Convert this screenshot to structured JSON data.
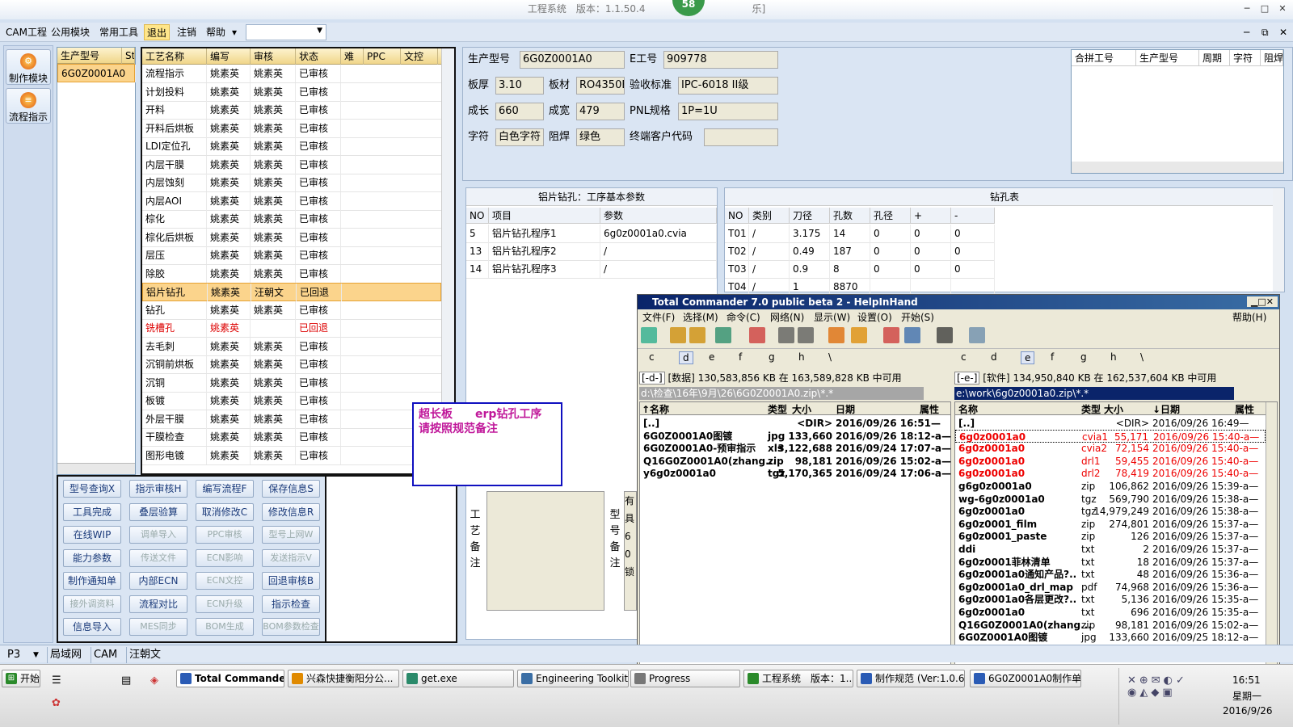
{
  "title": {
    "text": "工程系统　版本：1.1.50.4　　　　　　　　　　　乐]",
    "badge": "58",
    "min": "─",
    "max": "□",
    "close": "✕"
  },
  "menu": [
    "CAM工程",
    "公用模块",
    "常用工具",
    "退出",
    "注销",
    "帮助",
    "▾"
  ],
  "mdi_controls": {
    "min": "─",
    "restore": "⧉",
    "close": "✕"
  },
  "nav": [
    {
      "label": "制作模块",
      "icon": "gear-icon"
    },
    {
      "label": "流程指示",
      "icon": "flow-icon"
    }
  ],
  "prodlist": {
    "headers": [
      "生产型号",
      "St"
    ],
    "rows": [
      "6G0Z0001A0"
    ]
  },
  "process": {
    "headers": [
      "工艺名称",
      "编写",
      "审核",
      "状态",
      "难",
      "PPC",
      "文控"
    ],
    "rows": [
      [
        "流程指示",
        "姚素英",
        "姚素英",
        "已审核"
      ],
      [
        "计划投料",
        "姚素英",
        "姚素英",
        "已审核"
      ],
      [
        "开料",
        "姚素英",
        "姚素英",
        "已审核"
      ],
      [
        "开料后烘板",
        "姚素英",
        "姚素英",
        "已审核"
      ],
      [
        "LDI定位孔",
        "姚素英",
        "姚素英",
        "已审核"
      ],
      [
        "内层干膜",
        "姚素英",
        "姚素英",
        "已审核"
      ],
      [
        "内层蚀刻",
        "姚素英",
        "姚素英",
        "已审核"
      ],
      [
        "内层AOI",
        "姚素英",
        "姚素英",
        "已审核"
      ],
      [
        "棕化",
        "姚素英",
        "姚素英",
        "已审核"
      ],
      [
        "棕化后烘板",
        "姚素英",
        "姚素英",
        "已审核"
      ],
      [
        "层压",
        "姚素英",
        "姚素英",
        "已审核"
      ],
      [
        "除胶",
        "姚素英",
        "姚素英",
        "已审核"
      ],
      [
        "铝片钻孔",
        "姚素英",
        "汪朝文",
        "已回退"
      ],
      [
        "钻孔",
        "姚素英",
        "姚素英",
        "已审核"
      ],
      [
        "铣槽孔",
        "姚素英",
        "",
        "已回退"
      ],
      [
        "去毛刺",
        "姚素英",
        "姚素英",
        "已审核"
      ],
      [
        "沉铜前烘板",
        "姚素英",
        "姚素英",
        "已审核"
      ],
      [
        "沉铜",
        "姚素英",
        "姚素英",
        "已审核"
      ],
      [
        "板镀",
        "姚素英",
        "姚素英",
        "已审核"
      ],
      [
        "外层干膜",
        "姚素英",
        "姚素英",
        "已审核"
      ],
      [
        "干膜检查",
        "姚素英",
        "姚素英",
        "已审核"
      ],
      [
        "图形电镀",
        "姚素英",
        "姚素英",
        "已审核"
      ]
    ],
    "selected_index": 12,
    "red_index": 14
  },
  "info": {
    "prod_label": "生产型号",
    "prod_value": "6G0Z0001A0",
    "e_label": "E工号",
    "e_value": "909778",
    "thick_label": "板厚",
    "thick_value": "3.10",
    "mat_label": "板材",
    "mat_value": "RO4350B",
    "std_label": "验收标准",
    "std_value": "IPC-6018 II级",
    "len_label": "成长",
    "len_value": "660",
    "wid_label": "成宽",
    "wid_value": "479",
    "pnl_label": "PNL规格",
    "pnl_value": "1P=1U",
    "char_label": "字符",
    "char_value": "白色字符",
    "mask_label": "阻焊",
    "mask_value": "绿色",
    "cust_label": "终端客户代码",
    "cust_value": ""
  },
  "merge": {
    "headers": [
      "合拼工号",
      "生产型号",
      "周期",
      "字符",
      "阻焊"
    ]
  },
  "alu": {
    "title": "铝片钻孔：工序基本参数",
    "headers": [
      "NO",
      "项目",
      "参数"
    ],
    "rows": [
      [
        "5",
        "铝片钻孔程序1",
        "6g0z0001a0.cvia"
      ],
      [
        "13",
        "铝片钻孔程序2",
        "/"
      ],
      [
        "14",
        "铝片钻孔程序3",
        "/"
      ]
    ]
  },
  "drill": {
    "title": "钻孔表",
    "headers": [
      "NO",
      "类别",
      "刀径",
      "孔数",
      "孔径",
      "+",
      "-"
    ],
    "rows": [
      [
        "T01",
        "/",
        "3.175",
        "14",
        "0",
        "0",
        "0"
      ],
      [
        "T02",
        "/",
        "0.49",
        "187",
        "0",
        "0",
        "0"
      ],
      [
        "T03",
        "/",
        "0.9",
        "8",
        "0",
        "0",
        "0"
      ],
      [
        "T04",
        "/",
        "1",
        "8870",
        "",
        "",
        ""
      ]
    ]
  },
  "note_popup": "超长板　　erp钻孔工序\n请按照规范备注",
  "buttons": [
    [
      "型号查询X",
      "指示审核H",
      "编写流程F",
      "保存信息S"
    ],
    [
      "工具完成",
      "叠层验算",
      "取消修改C",
      "修改信息R"
    ],
    [
      "在线WIP",
      "调单导入",
      "PPC审核",
      "型号上网W"
    ],
    [
      "能力参数",
      "传送文件",
      "ECN影响",
      "发送指示V"
    ],
    [
      "制作通知单",
      "内部ECN",
      "ECN文控",
      "回退审核B"
    ],
    [
      "接外调资料",
      "流程对比",
      "ECN升级",
      "指示检查"
    ],
    [
      "信息导入",
      "MES同步",
      "BOM生成",
      "BOM参数检查"
    ]
  ],
  "buttons_disabled": [
    [
      2,
      1
    ],
    [
      2,
      2
    ],
    [
      2,
      3
    ],
    [
      3,
      1
    ],
    [
      3,
      2
    ],
    [
      3,
      3
    ],
    [
      4,
      2
    ],
    [
      5,
      0
    ],
    [
      5,
      2
    ],
    [
      6,
      1
    ],
    [
      6,
      2
    ],
    [
      6,
      3
    ]
  ],
  "remarks": {
    "process": "工艺备注",
    "model": "型号备注",
    "model_short": "有具60锁"
  },
  "tc": {
    "title": "Total Commander 7.0 public beta 2 - HelpInHand",
    "menu": [
      "文件(F)",
      "选择(M)",
      "命令(C)",
      "网络(N)",
      "显示(W)",
      "设置(O)",
      "开始(S)"
    ],
    "help": "帮助(H)",
    "left": {
      "drive": "[-d-]",
      "vol": "[数据]",
      "free": "130,583,856 KB 在 163,589,828 KB 中可用",
      "path": "d:\\检查\\16年\\9月\\26\\6G0Z0001A0.zip\\*.*",
      "drives": [
        "c",
        "d",
        "e",
        "f",
        "g",
        "h",
        "\\"
      ],
      "headers": [
        "↑名称",
        "类型",
        "大小",
        "日期",
        "属性"
      ],
      "files": [
        [
          "[..]",
          "",
          "<DIR>",
          "2016/09/26 16:51—",
          ""
        ],
        [
          "6G0Z0001A0图镀",
          "jpg",
          "133,660",
          "2016/09/26 18:12-a—",
          ""
        ],
        [
          "6G0Z0001A0-预审指示",
          "xls",
          "3,122,688",
          "2016/09/24 17:07-a—",
          ""
        ],
        [
          "Q16G0Z0001A0(zhang...",
          "zip",
          "98,181",
          "2016/09/26 15:02-a—",
          ""
        ],
        [
          "y6g0z0001a0",
          "tgz",
          "5,170,365",
          "2016/09/24 17:06-a—",
          ""
        ]
      ]
    },
    "right": {
      "drive": "[-e-]",
      "vol": "[软件]",
      "free": "134,950,840 KB 在 162,537,604 KB 中可用",
      "path": "e:\\work\\6g0z0001a0.zip\\*.*",
      "drives": [
        "c",
        "d",
        "e",
        "f",
        "g",
        "h",
        "\\"
      ],
      "headers": [
        "名称",
        "类型",
        "大小",
        "↓日期",
        "属性"
      ],
      "files": [
        [
          "[..]",
          "",
          "<DIR>",
          "2016/09/26 16:49—"
        ],
        [
          "6g0z0001a0",
          "cvia1",
          "55,171",
          "2016/09/26 15:40-a—"
        ],
        [
          "6g0z0001a0",
          "cvia2",
          "72,154",
          "2016/09/26 15:40-a—"
        ],
        [
          "6g0z0001a0",
          "drl1",
          "59,455",
          "2016/09/26 15:40-a—"
        ],
        [
          "6g0z0001a0",
          "drl2",
          "78,419",
          "2016/09/26 15:40-a—"
        ],
        [
          "g6g0z0001a0",
          "zip",
          "106,862",
          "2016/09/26 15:39-a—"
        ],
        [
          "wg-6g0z0001a0",
          "tgz",
          "569,790",
          "2016/09/26 15:38-a—"
        ],
        [
          "6g0z0001a0",
          "tgz",
          "14,979,249",
          "2016/09/26 15:38-a—"
        ],
        [
          "6g0z0001_film",
          "zip",
          "274,801",
          "2016/09/26 15:37-a—"
        ],
        [
          "6g0z0001_paste",
          "zip",
          "126",
          "2016/09/26 15:37-a—"
        ],
        [
          "ddi",
          "txt",
          "2",
          "2016/09/26 15:37-a—"
        ],
        [
          "6g0z0001菲林清单",
          "txt",
          "18",
          "2016/09/26 15:37-a—"
        ],
        [
          "6g0z0001a0通知产品?..",
          "txt",
          "48",
          "2016/09/26 15:36-a—"
        ],
        [
          "6g0z0001a0_drl_map",
          "pdf",
          "74,968",
          "2016/09/26 15:36-a—"
        ],
        [
          "6g0z0001a0各层更改?..",
          "txt",
          "5,136",
          "2016/09/26 15:35-a—"
        ],
        [
          "6g0z0001a0",
          "txt",
          "696",
          "2016/09/26 15:35-a—"
        ],
        [
          "Q16G0Z0001A0(zhang...",
          "zip",
          "98,181",
          "2016/09/26 15:02-a—"
        ],
        [
          "6G0Z0001A0图镀",
          "jpg",
          "133,660",
          "2016/09/25 18:12-a—"
        ]
      ],
      "red_count": 4
    }
  },
  "tabs": [
    "P3",
    "局域网",
    "CAM",
    "汪朝文"
  ],
  "taskbar": {
    "start": "开始",
    "tasks": [
      "Total Commander ...",
      "兴森快捷衡阳分公...",
      "get.exe",
      "Engineering Toolkit 9...",
      "Progress",
      "工程系统　版本：1...",
      "制作规范 (Ver:1.0.6)",
      "6G0Z0001A0制作单..."
    ],
    "time": "16:51",
    "day": "星期一",
    "date": "2016/9/26"
  }
}
